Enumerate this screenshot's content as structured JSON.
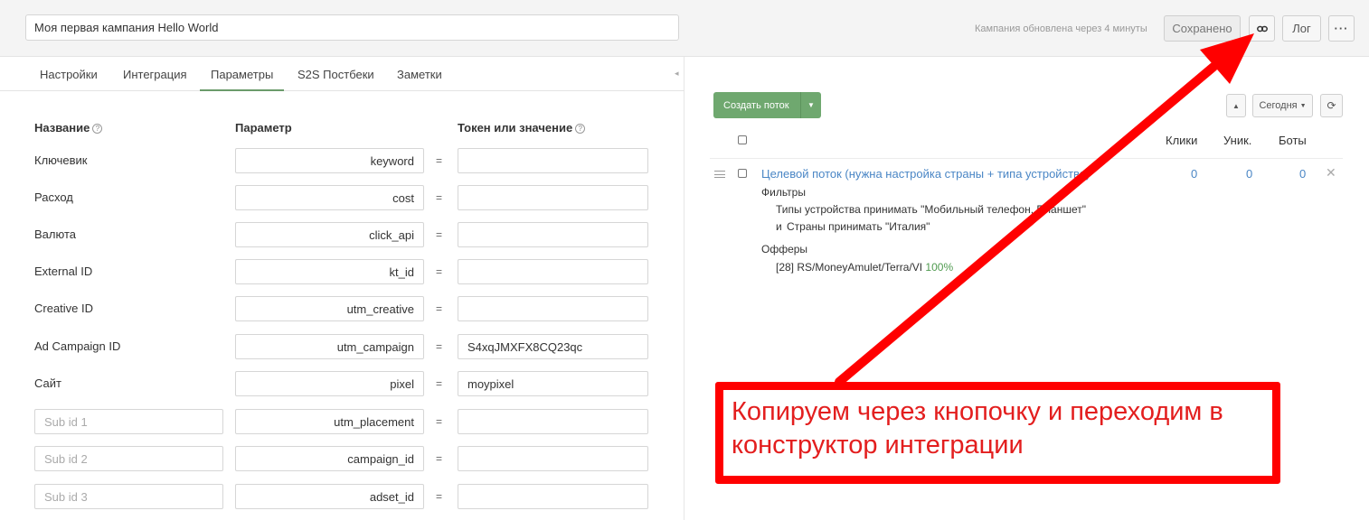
{
  "header": {
    "campaign_name": "Моя первая кампания Hello World",
    "updated_text": "Кампания обновлена через 4 минуты",
    "saved_label": "Сохранено",
    "log_label": "Лог",
    "more_label": "···"
  },
  "tabs": [
    {
      "label": "Настройки"
    },
    {
      "label": "Интеграция"
    },
    {
      "label": "Параметры",
      "active": true
    },
    {
      "label": "S2S Постбеки"
    },
    {
      "label": "Заметки"
    }
  ],
  "columns": {
    "name": "Название",
    "param": "Параметр",
    "token": "Токен или значение"
  },
  "params": [
    {
      "label": "Ключевик",
      "param": "keyword",
      "token": ""
    },
    {
      "label": "Расход",
      "param": "cost",
      "token": ""
    },
    {
      "label": "Валюта",
      "param": "click_api",
      "token": ""
    },
    {
      "label": "External ID",
      "param": "kt_id",
      "token": ""
    },
    {
      "label": "Creative ID",
      "param": "utm_creative",
      "token": ""
    },
    {
      "label": "Ad Campaign ID",
      "param": "utm_campaign",
      "token": "S4xqJMXFX8CQ23qc"
    },
    {
      "label": "Сайт",
      "param": "pixel",
      "token": "moypixel"
    },
    {
      "placeholder": "Sub id 1",
      "param": "utm_placement",
      "token": ""
    },
    {
      "placeholder": "Sub id 2",
      "param": "campaign_id",
      "token": ""
    },
    {
      "placeholder": "Sub id 3",
      "param": "adset_id",
      "token": ""
    }
  ],
  "streams": {
    "create_label": "Создать поток",
    "period_label": "Сегодня",
    "headers": {
      "clicks": "Клики",
      "unique": "Уник.",
      "bots": "Боты"
    },
    "flow": {
      "name": "Целевой поток (нужна настройка страны + типа устройства)",
      "clicks": "0",
      "unique": "0",
      "bots": "0",
      "filters_label": "Фильтры",
      "filter_1": "Типы устройства принимать \"Мобильный телефон, Планшет\"",
      "filter_and": "и",
      "filter_2": "Страны принимать \"Италия\"",
      "offers_label": "Офферы",
      "offer_text": "[28] RS/MoneyAmulet/Terra/VI",
      "offer_share": "100%"
    }
  },
  "annotation": {
    "text": "Копируем через кнопочку и переходим в конструктор интеграции"
  },
  "colors": {
    "accent_green": "#6fa86f",
    "link_blue": "#4a86c5",
    "annotation_red": "#ff0000"
  }
}
